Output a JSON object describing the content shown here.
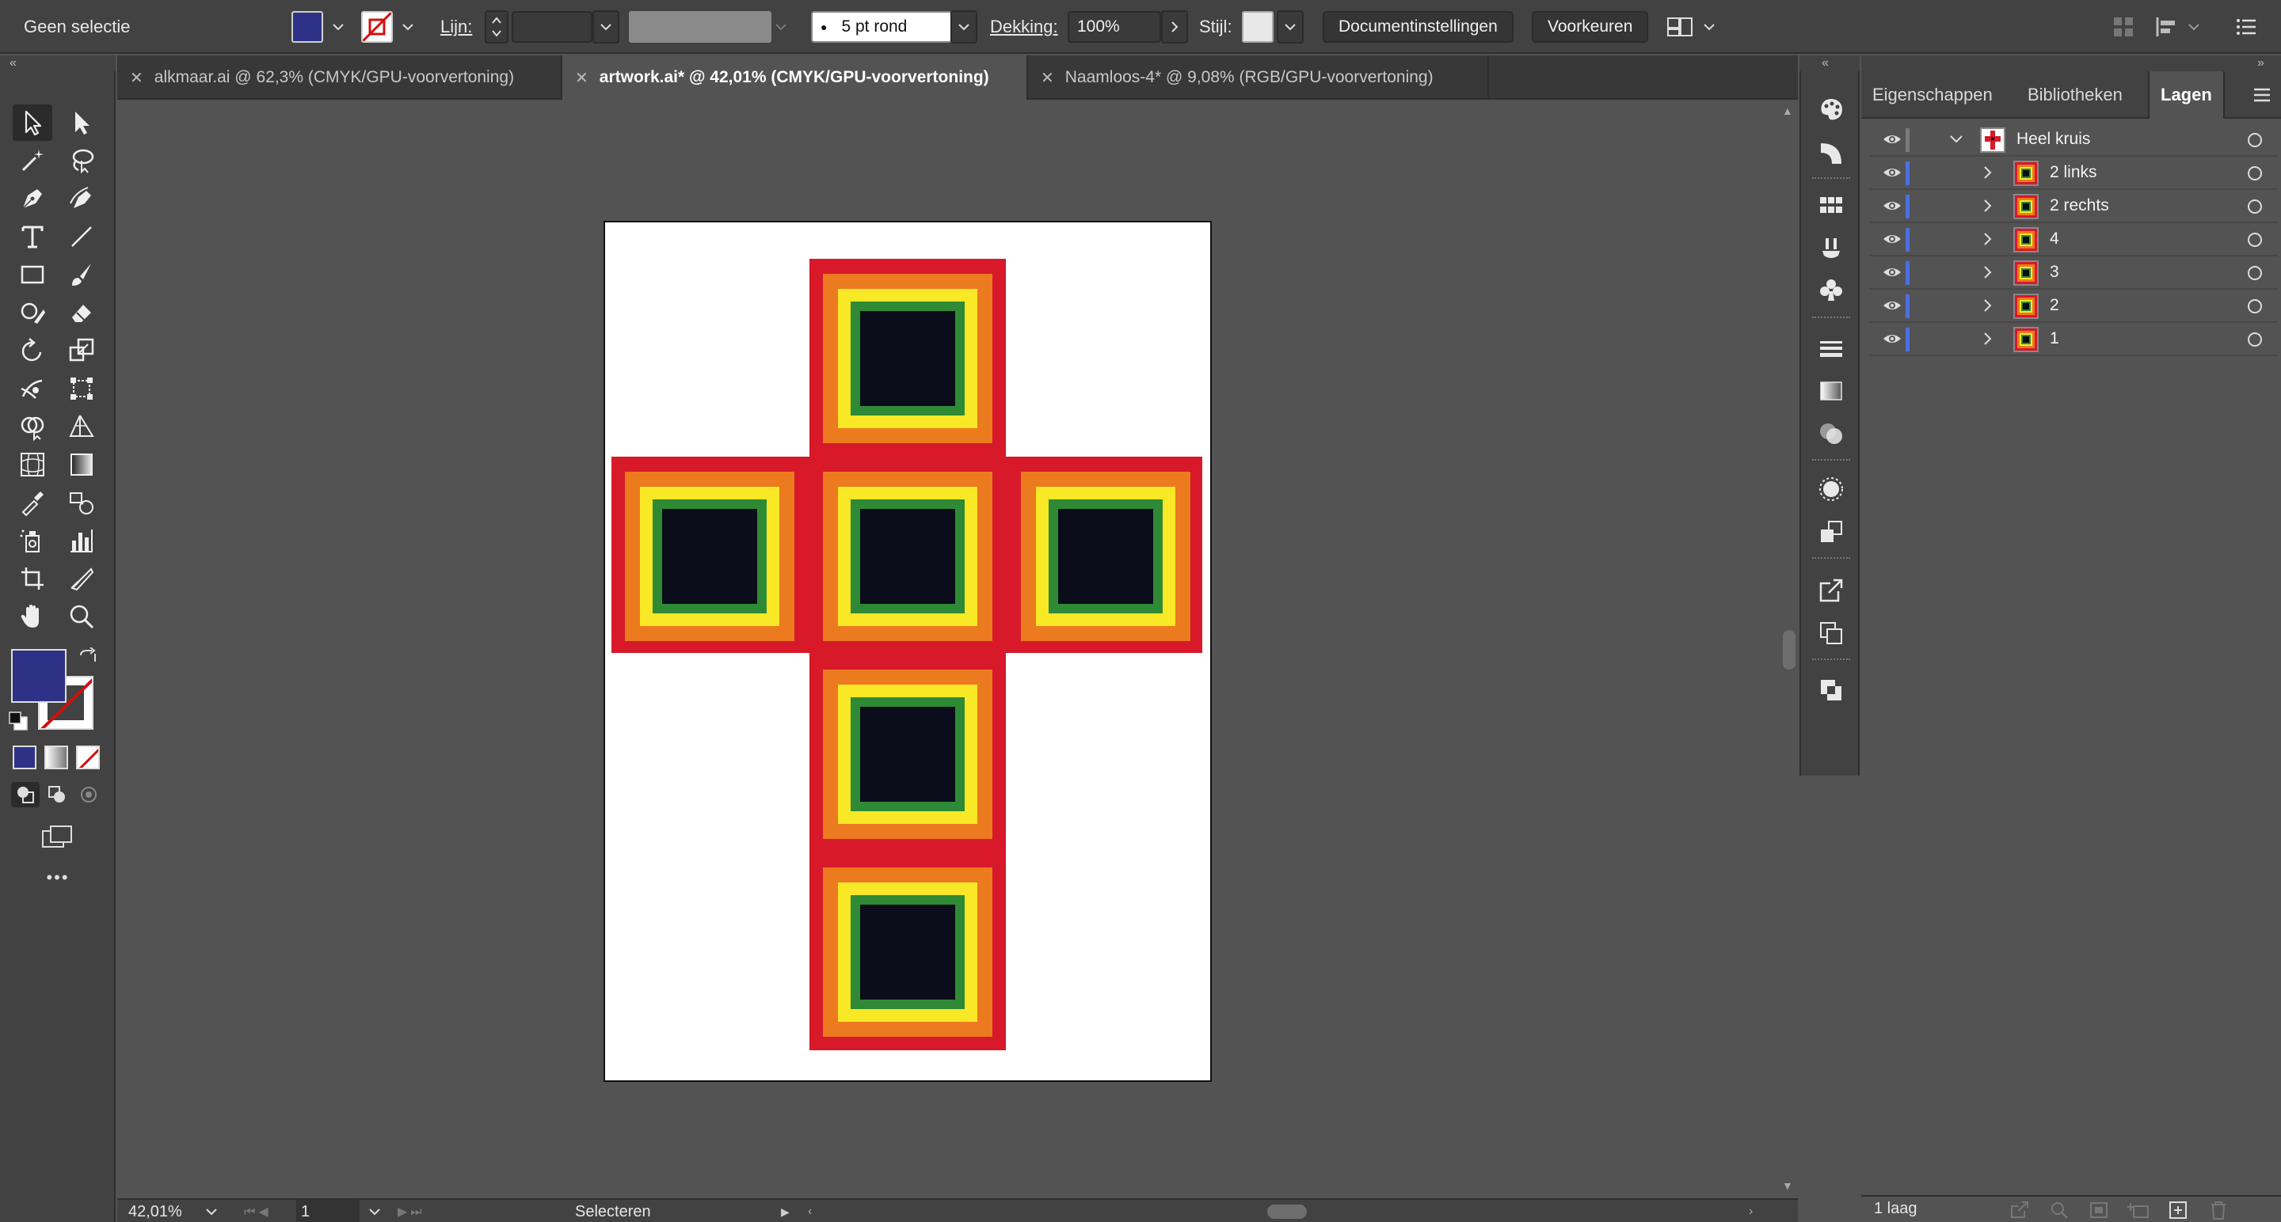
{
  "control_bar": {
    "selection_label": "Geen selectie",
    "fill_color": "#2e3286",
    "stroke_label": "Lijn:",
    "brush_value": "5 pt rond",
    "opacity_label": "Dekking:",
    "opacity_value": "100%",
    "style_label": "Stijl:",
    "doc_settings_button": "Documentinstellingen",
    "preferences_button": "Voorkeuren"
  },
  "tabs": [
    {
      "close": "✕",
      "label": "alkmaar.ai @ 62,3% (CMYK/GPU-voorvertoning)",
      "active": false
    },
    {
      "close": "✕",
      "label": "artwork.ai* @ 42,01% (CMYK/GPU-voorvertoning)",
      "active": true
    },
    {
      "close": "✕",
      "label": "Naamloos-4* @ 9,08% (RGB/GPU-voorvertoning)",
      "active": false
    }
  ],
  "colors": {
    "red": "#d7192a",
    "orange": "#ec7a1f",
    "yellow": "#f8e825",
    "green": "#2e8a34",
    "dark": "#0b0d1a",
    "layer_color": "#4d6fe0"
  },
  "status_bar": {
    "zoom": "42,01%",
    "artboard_number": "1",
    "tool_status": "Selecteren"
  },
  "panel": {
    "tabs": [
      "Eigenschappen",
      "Bibliotheken",
      "Lagen"
    ],
    "active_tab": "Lagen",
    "layers": [
      {
        "name": "Heel kruis",
        "level": 0,
        "expanded": true
      },
      {
        "name": "2 links",
        "level": 1,
        "expanded": false
      },
      {
        "name": "2 rechts",
        "level": 1,
        "expanded": false
      },
      {
        "name": "4",
        "level": 1,
        "expanded": false
      },
      {
        "name": "3",
        "level": 1,
        "expanded": false
      },
      {
        "name": "2",
        "level": 1,
        "expanded": false
      },
      {
        "name": "1",
        "level": 1,
        "expanded": false
      }
    ],
    "footer_count": "1 laag"
  },
  "toolbar": {
    "tools": [
      "selection-tool-icon",
      "direct-selection-tool-icon",
      "magic-wand-tool-icon",
      "lasso-tool-icon",
      "pen-tool-icon",
      "curvature-tool-icon",
      "type-tool-icon",
      "line-tool-icon",
      "rectangle-tool-icon",
      "paintbrush-tool-icon",
      "shaper-tool-icon",
      "eraser-tool-icon",
      "rotate-tool-icon",
      "scale-tool-icon",
      "warp-tool-icon",
      "free-transform-tool-icon",
      "shape-builder-tool-icon",
      "perspective-grid-tool-icon",
      "mesh-tool-icon",
      "gradient-tool-icon",
      "eyedropper-tool-icon",
      "blend-tool-icon",
      "symbol-sprayer-tool-icon",
      "column-graph-tool-icon",
      "artboard-tool-icon",
      "slice-tool-icon",
      "hand-tool-icon",
      "zoom-tool-icon"
    ],
    "fill_color": "#2e3286",
    "more_label": "•••"
  }
}
